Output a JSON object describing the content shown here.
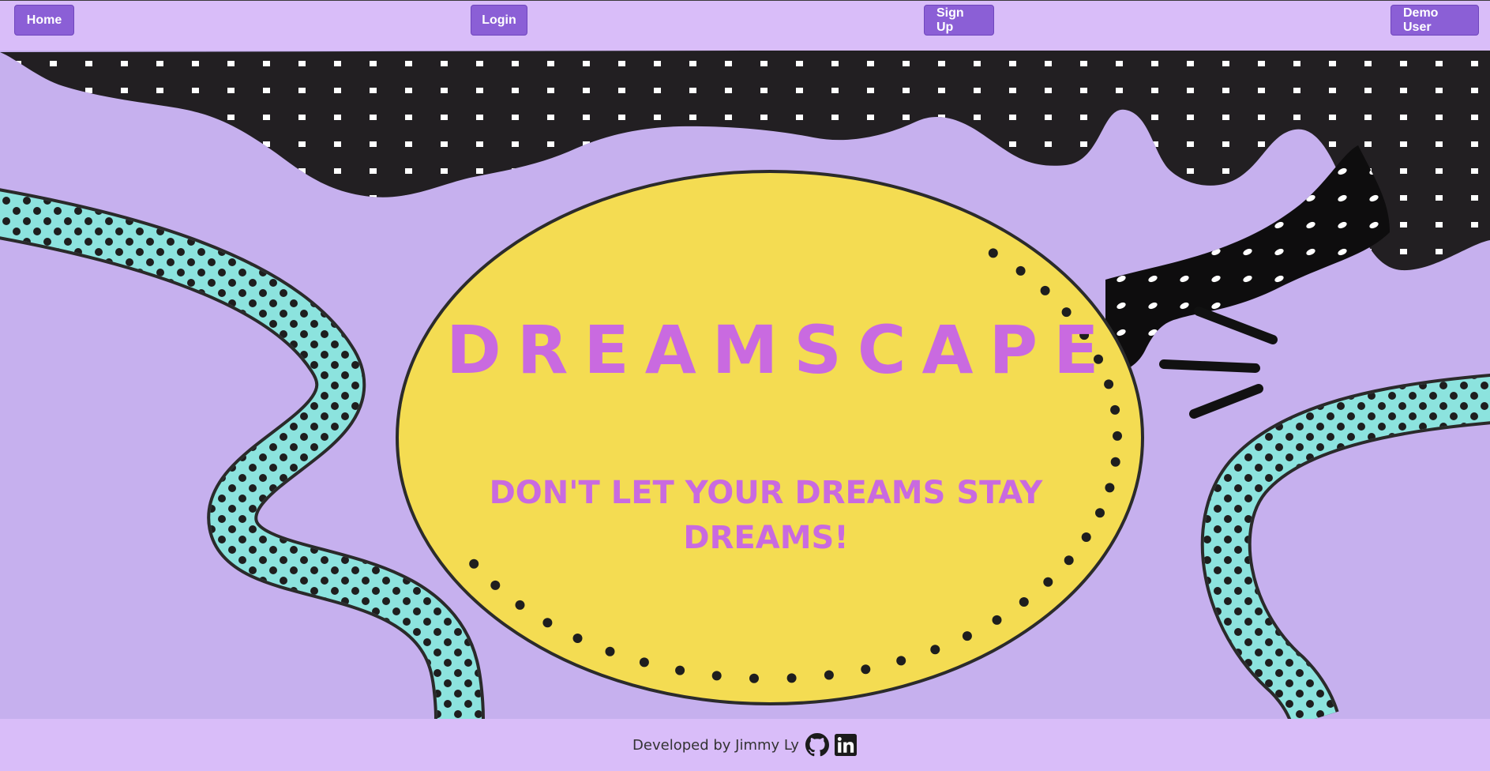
{
  "nav": {
    "home_label": "Home",
    "login_label": "Login",
    "signup_label": "Sign Up",
    "demo_label": "Demo User"
  },
  "hero": {
    "brand": "DREAMSCAPE",
    "tagline_line1": "DON'T LET YOUR DREAMS STAY",
    "tagline_line2": "DREAMS!"
  },
  "footer": {
    "credit": "Developed by Jimmy Ly",
    "icons": [
      "github-icon",
      "linkedin-icon"
    ]
  },
  "colors": {
    "nav_bg": "#d9bdf9",
    "button": "#8b5fd6",
    "hero_bg": "#c6b0ee",
    "sun_yellow": "#f4dc52",
    "title_pink": "#c96ae0",
    "ribbon_teal": "#8ce3de",
    "blob_dark": "#221f22"
  }
}
